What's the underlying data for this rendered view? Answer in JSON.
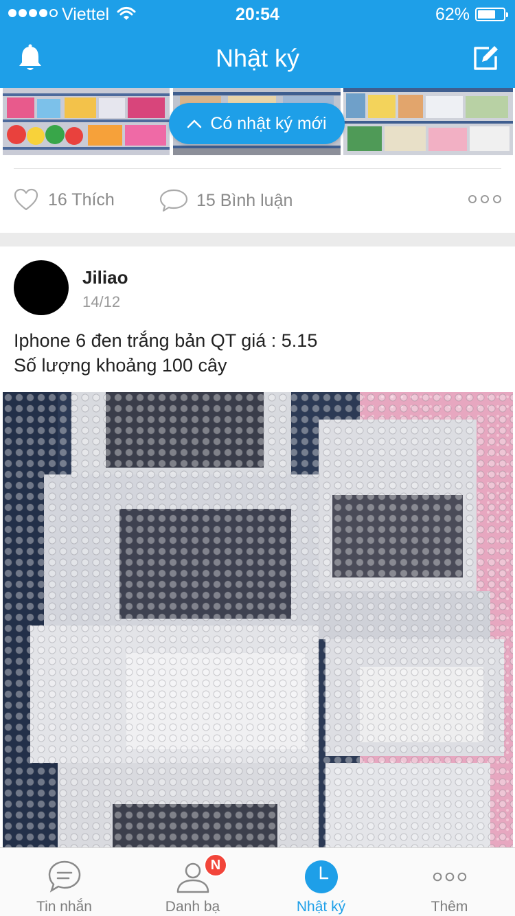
{
  "status_bar": {
    "carrier": "Viettel",
    "time": "20:54",
    "battery_percent": "62%",
    "battery_level": 0.62,
    "signal_bars_filled": 4,
    "signal_bars_total": 5
  },
  "header": {
    "title": "Nhật ký",
    "left_icon": "bell-icon",
    "right_icon": "compose-icon"
  },
  "previous_post": {
    "new_posts_banner": "Có nhật ký mới",
    "likes": "16 Thích",
    "comments": "15 Bình luận"
  },
  "post": {
    "author": "Jiliao",
    "date": "14/12",
    "text_line1": "Iphone 6 đen trắng bản QT giá : 5.15",
    "text_line2": "Số lượng khoảng 100 cây"
  },
  "tabbar": {
    "tabs": [
      {
        "label": "Tin nhắn",
        "icon": "chat-bubble-icon",
        "active": false
      },
      {
        "label": "Danh bạ",
        "icon": "contacts-icon",
        "active": false,
        "badge": "N"
      },
      {
        "label": "Nhật ký",
        "icon": "clock-icon",
        "active": true
      },
      {
        "label": "Thêm",
        "icon": "more-dots-icon",
        "active": false
      }
    ]
  },
  "colors": {
    "brand_blue": "#1e9fe8",
    "badge_red": "#f2453a",
    "muted_gray": "#8a8a8a"
  }
}
